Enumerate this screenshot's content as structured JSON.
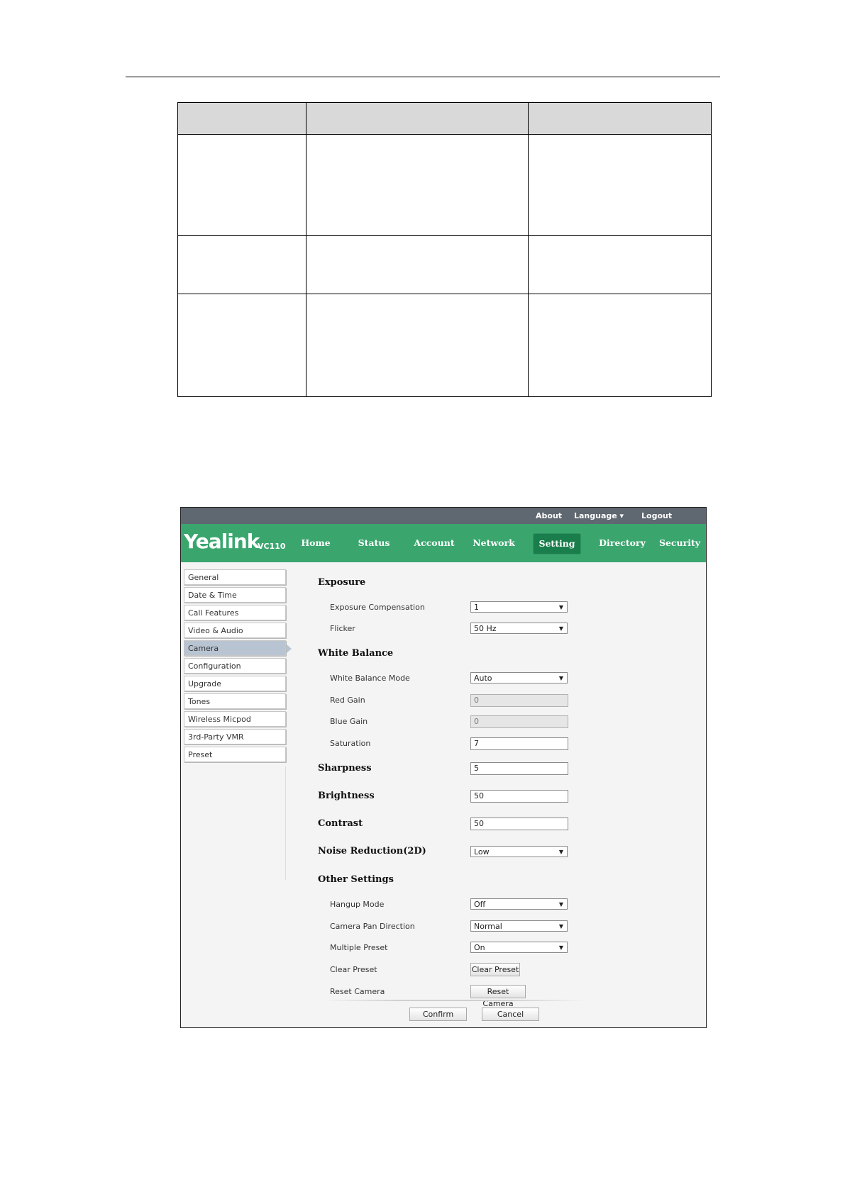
{
  "topbar": {
    "about": "About",
    "language": "Language ▾",
    "logout": "Logout"
  },
  "brand": {
    "logo": "Yealink",
    "model": "VC110"
  },
  "nav": [
    {
      "label": "Home"
    },
    {
      "label": "Status"
    },
    {
      "label": "Account"
    },
    {
      "label": "Network"
    },
    {
      "label": "Setting"
    },
    {
      "label": "Directory"
    },
    {
      "label": "Security"
    }
  ],
  "nav_active": "Setting",
  "sidebar": [
    {
      "label": "General"
    },
    {
      "label": "Date & Time"
    },
    {
      "label": "Call Features"
    },
    {
      "label": "Video & Audio"
    },
    {
      "label": "Camera"
    },
    {
      "label": "Configuration"
    },
    {
      "label": "Upgrade"
    },
    {
      "label": "Tones"
    },
    {
      "label": "Wireless Micpod"
    },
    {
      "label": "3rd-Party VMR"
    },
    {
      "label": "Preset"
    }
  ],
  "sidebar_active": "Camera",
  "form": {
    "exposure": {
      "heading": "Exposure",
      "compensation_label": "Exposure Compensation",
      "compensation_value": "1",
      "flicker_label": "Flicker",
      "flicker_value": "50 Hz"
    },
    "white_balance": {
      "heading": "White Balance",
      "mode_label": "White Balance Mode",
      "mode_value": "Auto",
      "red_gain_label": "Red Gain",
      "red_gain_value": "0",
      "blue_gain_label": "Blue Gain",
      "blue_gain_value": "0",
      "saturation_label": "Saturation",
      "saturation_value": "7"
    },
    "sharpness": {
      "label": "Sharpness",
      "value": "5"
    },
    "brightness": {
      "label": "Brightness",
      "value": "50"
    },
    "contrast": {
      "label": "Contrast",
      "value": "50"
    },
    "noise_reduction": {
      "label": "Noise Reduction(2D)",
      "value": "Low"
    },
    "other": {
      "heading": "Other Settings",
      "hangup_label": "Hangup Mode",
      "hangup_value": "Off",
      "pan_label": "Camera Pan Direction",
      "pan_value": "Normal",
      "multi_preset_label": "Multiple Preset",
      "multi_preset_value": "On",
      "clear_preset_label": "Clear Preset",
      "clear_preset_button": "Clear Preset",
      "reset_camera_label": "Reset Camera",
      "reset_camera_button": "Reset Camera"
    }
  },
  "footer": {
    "confirm": "Confirm",
    "cancel": "Cancel"
  },
  "colors": {
    "topbar": "#5f6770",
    "navbar": "#3aa66e",
    "nav_active": "#1a7d4c",
    "sidebar_active": "#b8c4d2"
  }
}
